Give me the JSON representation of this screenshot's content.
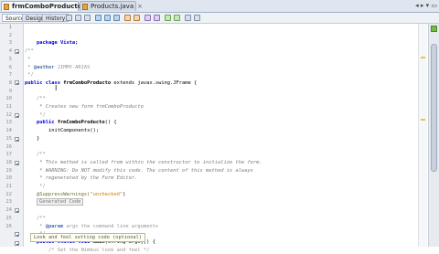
{
  "tabs": [
    {
      "label": "frmComboProducto.java",
      "active": true,
      "close": "×"
    },
    {
      "label": "Products.java",
      "active": false,
      "close": "×"
    }
  ],
  "tab_overflow": "◂ ▸ ▾ ▭",
  "toolbar": {
    "source_label": "Source",
    "design_label": "Design",
    "history_label": "History"
  },
  "line_numbers": [
    "1",
    "2",
    "3",
    "4",
    "5",
    "6",
    "7",
    "8",
    "9",
    "10",
    "11",
    "12",
    "13",
    "14",
    "15",
    "16",
    "17",
    "18",
    "19",
    "20",
    "21",
    "22",
    "23",
    "24",
    "25",
    "26"
  ],
  "code": {
    "l3": "package Vista;",
    "l5": "/**",
    "l6": " *",
    "l7_star": " * ",
    "l7_tag": "@author",
    "l7_rest": " JIMMY-ARIAS",
    "l8": " */",
    "l9_kw": "public class ",
    "l9_name": "frmComboProducto",
    "l9_rest": " extends javax.swing.JFrame {",
    "l11": "    /**",
    "l12": "     * Creates new form frmComboProducto",
    "l13": "     */",
    "l14_kw": "    public ",
    "l14_name": "frmComboProducto",
    "l14_rest": "() {",
    "l15": "        initComponents();",
    "l16": "    }",
    "l18": "    /**",
    "l19": "     * This method is called from within the constructor to initialize the form.",
    "l20": "     * WARNING: Do NOT modify this code. The content of this method is always",
    "l21": "     * regenerated by the Form Editor.",
    "l22": "     */",
    "l23_an": "    @SuppressWarnings(",
    "l23_st": "\"unchecked\"",
    "l23_end": ")",
    "l24_folded": "Generated Code",
    "l26": "    /**",
    "l27_star": "     * ",
    "l27_tag": "@param",
    "l27_rest": " args the command line arguments",
    "l28": "     */",
    "l29_kw": "    public static void ",
    "l29_name": "main",
    "l29_rest": "(String args[]) {",
    "l30": "        /* Set the Nimbus look and feel */",
    "l31_folded": "Look and feel setting code (optional)"
  },
  "colors": {
    "keyword": "#0000e6",
    "comment": "#969696",
    "string": "#ce7b00",
    "annotation": "#6f6f2f"
  }
}
